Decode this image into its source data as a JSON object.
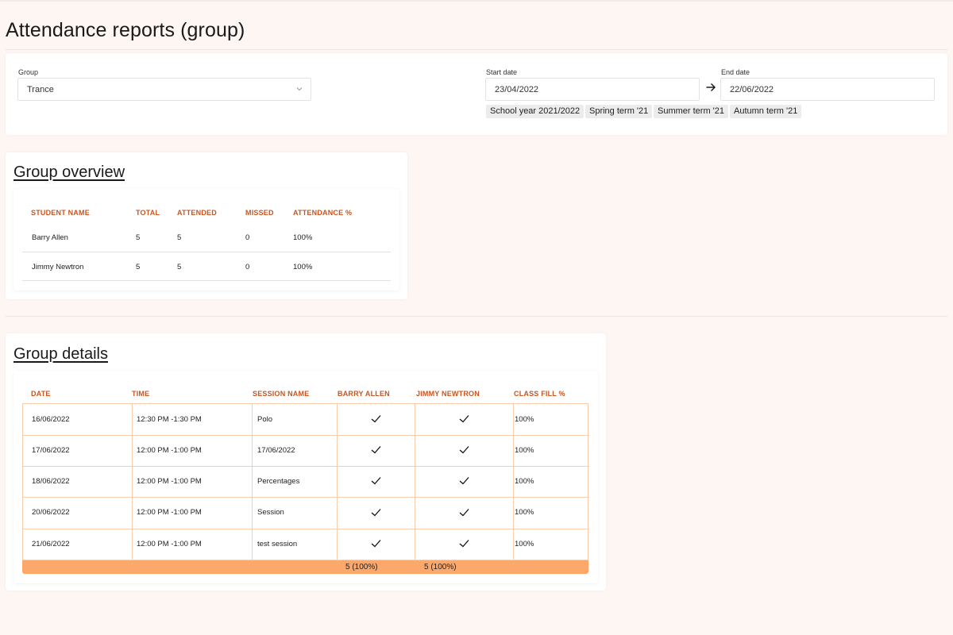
{
  "page": {
    "title": "Attendance reports (group)"
  },
  "filters": {
    "group_label": "Group",
    "group_value": "Trance",
    "start_label": "Start date",
    "start_value": "23/04/2022",
    "end_label": "End date",
    "end_value": "22/06/2022",
    "presets": [
      "School year 2021/2022",
      "Spring term '21",
      "Summer term '21",
      "Autumn term '21"
    ]
  },
  "overview": {
    "title": "Group overview",
    "columns": [
      "STUDENT NAME",
      "TOTAL",
      "ATTENDED",
      "MISSED",
      "ATTENDANCE %"
    ],
    "rows": [
      [
        "Barry Allen",
        "5",
        "5",
        "0",
        "100%"
      ],
      [
        "Jimmy Newtron",
        "5",
        "5",
        "0",
        "100%"
      ]
    ]
  },
  "details": {
    "title": "Group details",
    "columns": [
      "DATE",
      "TIME",
      "SESSION NAME",
      "BARRY ALLEN",
      "JIMMY NEWTRON",
      "CLASS FILL %"
    ],
    "rows": [
      [
        "16/06/2022",
        "12:30 PM -1:30 PM",
        "Polo",
        "100%"
      ],
      [
        "17/06/2022",
        "12:00 PM -1:00 PM",
        "17/06/2022",
        "100%"
      ],
      [
        "18/06/2022",
        "12:00 PM -1:00 PM",
        "Percentages",
        "100%"
      ],
      [
        "20/06/2022",
        "12:00 PM -1:00 PM",
        "Session",
        "100%"
      ],
      [
        "21/06/2022",
        "12:00 PM -1:00 PM",
        "test session",
        "100%"
      ]
    ],
    "attendance_marks": "check-icon",
    "totals": [
      "5 (100%)",
      "5 (100%)"
    ]
  },
  "colors": {
    "accent": "#c8551f",
    "totals_bar": "#fca86a",
    "grid_line": "#f8cfae",
    "background": "#fdf6f3"
  }
}
